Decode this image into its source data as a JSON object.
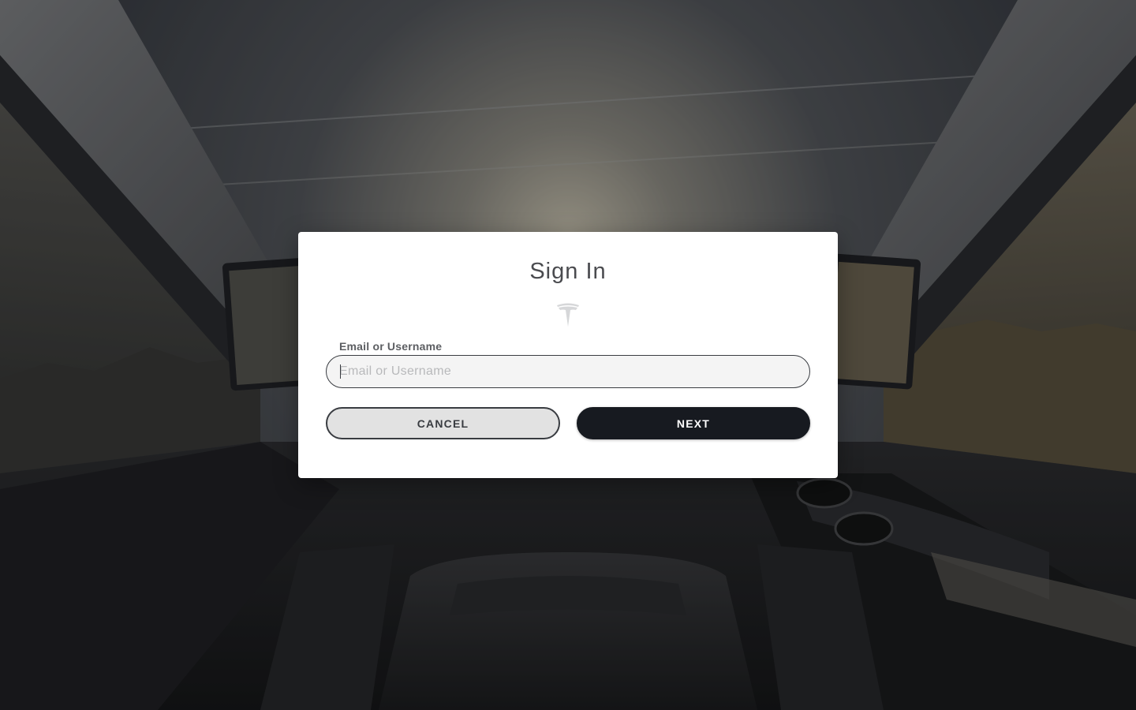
{
  "dialog": {
    "title": "Sign In",
    "logo_icon": "tesla-logo-icon",
    "field": {
      "label": "Email or Username",
      "value": "",
      "placeholder": "Email or Username"
    },
    "buttons": {
      "cancel_label": "CANCEL",
      "next_label": "NEXT"
    }
  },
  "colors": {
    "primary_button": "#171a20",
    "secondary_button": "#e2e2e2",
    "text": "#393c41"
  }
}
